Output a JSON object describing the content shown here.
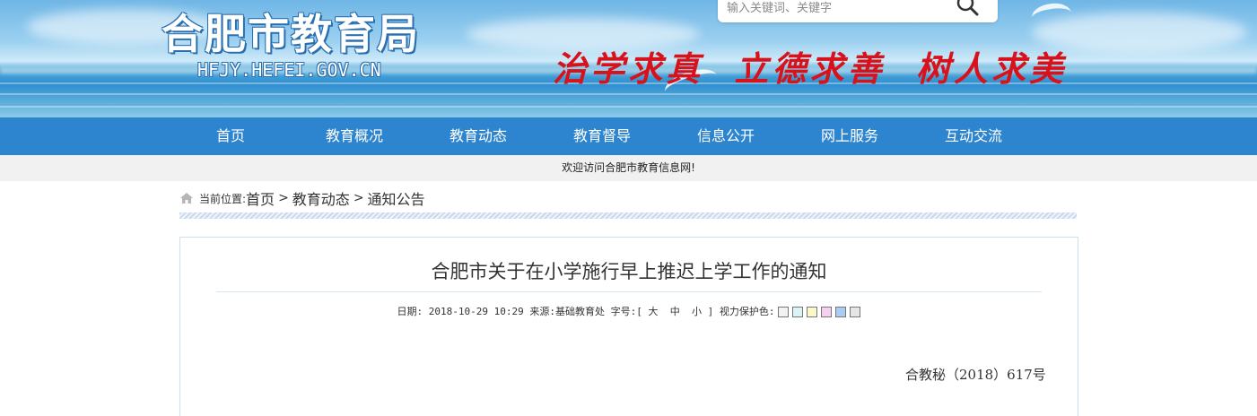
{
  "header": {
    "site_title": "合肥市教育局",
    "site_domain": "HFJY.HEFEI.GOV.CN",
    "slogan": "治学求真  立德求善  树人求美",
    "search": {
      "placeholder": "输入关键词、关键字",
      "button_icon": "search-icon"
    }
  },
  "nav": {
    "items": [
      "首页",
      "教育概况",
      "教育动态",
      "教育督导",
      "信息公开",
      "网上服务",
      "互动交流"
    ],
    "color": "#2d85cf"
  },
  "welcome": "欢迎访问合肥市教育信息网!",
  "breadcrumb": {
    "label": "当前位置:",
    "items": [
      "首页",
      "教育动态",
      "通知公告"
    ],
    "separator": ">"
  },
  "article": {
    "title": "合肥市关于在小学施行早上推迟上学工作的通知",
    "date_label": "日期:",
    "date": "2018-10-29 10:29",
    "source_label": "来源:",
    "source": "基础教育处",
    "font_size_label": "字号:",
    "font_sizes": [
      "大",
      "中",
      "小"
    ],
    "eye_color_label": "视力保护色:",
    "eye_colors": [
      "#f2f2f2",
      "#d9f3f7",
      "#fbf7c9",
      "#f5d0f0",
      "#a9cdf2",
      "#e6e6e6"
    ],
    "doc_number": "合教秘（2018）617号"
  }
}
